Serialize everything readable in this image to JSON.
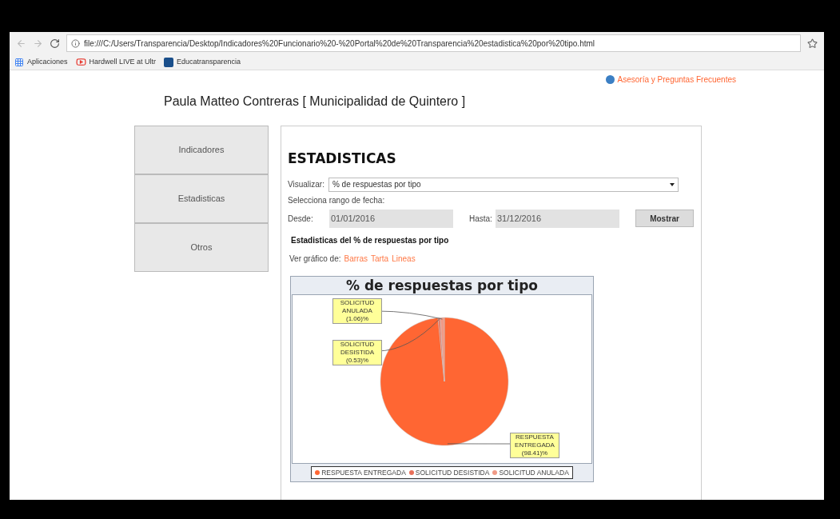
{
  "browser": {
    "url": "file:///C:/Users/Transparencia/Desktop/Indicadores%20Funcionario%20-%20Portal%20de%20Transparencia%20estadistica%20por%20tipo.html",
    "bookmarks": [
      {
        "label": "Aplicaciones",
        "kind": "apps"
      },
      {
        "label": "Hardwell LIVE at Ultr",
        "kind": "video"
      },
      {
        "label": "Educatransparencia",
        "kind": "site"
      }
    ]
  },
  "header": {
    "link": "Asesoría y Preguntas Frecuentes",
    "title": "Paula Matteo Contreras [ Municipalidad de Quintero ]"
  },
  "sidebar": {
    "items": [
      {
        "label": "Indicadores",
        "selected": false
      },
      {
        "label": "Estadisticas",
        "selected": false
      },
      {
        "label": "Otros",
        "selected": false
      }
    ]
  },
  "panel": {
    "heading": "ESTADISTICAS",
    "visualize_label": "Visualizar:",
    "visualize_value": "% de respuestas por tipo",
    "range_label": "Selecciona rango de fecha:",
    "from_label": "Desde:",
    "from_value": "01/01/2016",
    "to_label": "Hasta:",
    "to_value": "31/12/2016",
    "show_button": "Mostrar",
    "subtitle": "Estadisticas del % de respuestas por tipo",
    "chart_links_label": "Ver gráfico de:",
    "chart_links": [
      "Barras",
      "Tarta",
      "Lineas"
    ],
    "chart_data": {
      "type": "pie",
      "title": "% de respuestas por tipo",
      "categories": [
        "RESPUESTA ENTREGADA",
        "SOLICITUD DESISTIDA",
        "SOLICITUD ANULADA"
      ],
      "values": [
        98.41,
        0.53,
        1.06
      ],
      "colors": [
        "#ff6633",
        "#e8705a",
        "#f09a86"
      ],
      "legend": "bottom",
      "value_labels": [
        "RESPUESTA ENTREGADA (98.41)%",
        "SOLICITUD DESISTIDA (0.53)%",
        "SOLICITUD ANULADA (1.06)%"
      ]
    }
  }
}
